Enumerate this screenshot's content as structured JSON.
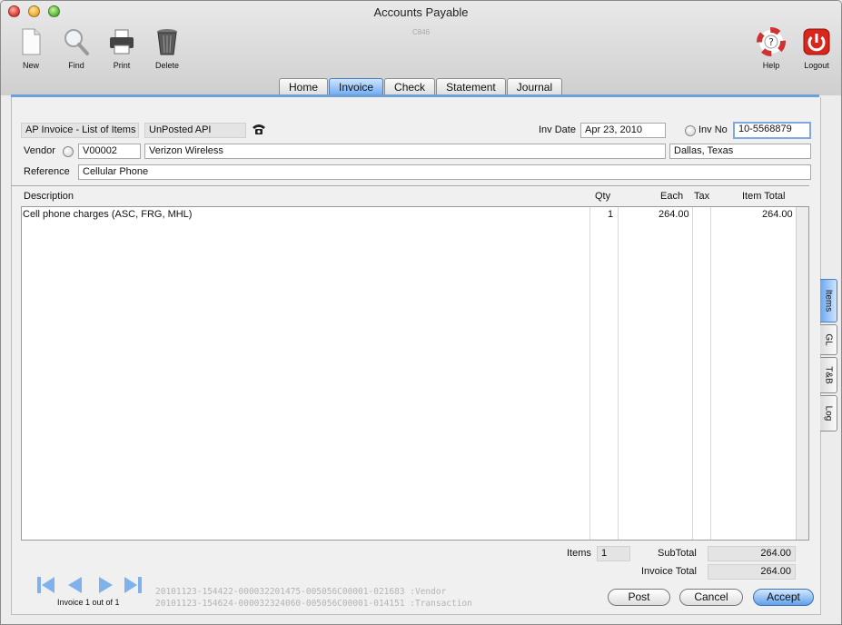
{
  "window": {
    "title": "Accounts Payable",
    "code": "C846"
  },
  "toolbar": {
    "new_label": "New",
    "find_label": "Find",
    "print_label": "Print",
    "delete_label": "Delete",
    "help_label": "Help",
    "logout_label": "Logout"
  },
  "tabs": [
    "Home",
    "Invoice",
    "Check",
    "Statement",
    "Journal"
  ],
  "active_tab": "Invoice",
  "header": {
    "list_label": "AP Invoice - List of Items",
    "status": "UnPosted API",
    "inv_date_label": "Inv Date",
    "inv_date": "Apr 23, 2010",
    "inv_no_label": "Inv No",
    "inv_no": "10-5568879",
    "vendor_label": "Vendor",
    "vendor_code": "V00002",
    "vendor_name": "Verizon Wireless",
    "vendor_location": "Dallas, Texas",
    "reference_label": "Reference",
    "reference": "Cellular Phone"
  },
  "items_table": {
    "columns": {
      "description": "Description",
      "qty": "Qty",
      "each": "Each",
      "tax": "Tax",
      "total": "Item Total"
    },
    "rows": [
      {
        "description": "Cell phone charges (ASC, FRG, MHL)",
        "qty": "1",
        "each": "264.00",
        "tax": "",
        "total": "264.00"
      }
    ]
  },
  "side_tabs": [
    "Items",
    "GL",
    "T&B",
    "Log"
  ],
  "totals": {
    "items_label": "Items",
    "items_count": "1",
    "subtotal_label": "SubTotal",
    "subtotal": "264.00",
    "invoice_total_label": "Invoice Total",
    "invoice_total": "264.00"
  },
  "footer": {
    "record_position": "Invoice 1 out of 1",
    "vendor_path": "20101123-154422-000032201475-005056C00001-021683 :Vendor",
    "transaction_path": "20101123-154624-000032324060-005056C00001-014151 :Transaction"
  },
  "buttons": {
    "post": "Post",
    "cancel": "Cancel",
    "accept": "Accept"
  },
  "colors": {
    "accent": "#6aa8ee",
    "logout": "#d9261c"
  }
}
